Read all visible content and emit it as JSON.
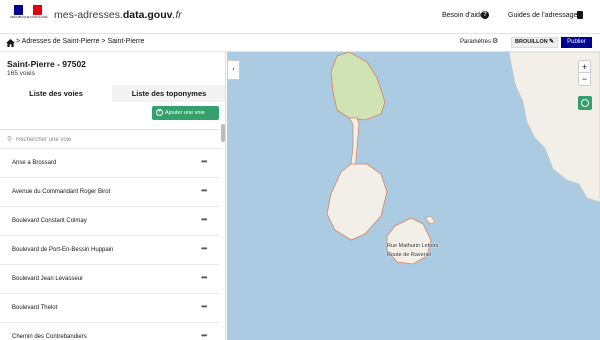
{
  "header": {
    "logo_text": "RÉPUBLIQUE FRANÇAISE",
    "site_prefix": "mes-adresses.",
    "site_brand": "data.gouv",
    "site_suffix": ".fr",
    "help_label": "Besoin d'aide",
    "guides_label": "Guides de l'adressage",
    "colors": {
      "blue": "#000091",
      "red": "#e1000f"
    }
  },
  "breadcrumb": {
    "path": "> Adresses de Saint-Pierre > Saint-Pierre",
    "settings_label": "Paramètres",
    "draft_label": "BROUILLON",
    "publish_label": "Publier"
  },
  "sidebar": {
    "commune_title": "Saint-Pierre - 97502",
    "voies_count": "165 voies",
    "tabs": [
      {
        "label": "Liste des voies",
        "active": true
      },
      {
        "label": "Liste des toponymes",
        "active": false
      }
    ],
    "add_button_label": "Ajouter une voie",
    "search_placeholder": "Rechercher une voie",
    "voies": [
      {
        "name": "Anse a Brossard"
      },
      {
        "name": "Avenue du Commandant Roger Birot"
      },
      {
        "name": "Boulevard Constant Colmay"
      },
      {
        "name": "Boulevard de Port-En-Bessin Huppain"
      },
      {
        "name": "Boulevard Jean Levasseur"
      },
      {
        "name": "Boulevard Thelot"
      },
      {
        "name": "Chemin des Contrebandiers"
      }
    ],
    "row_action_icon": "more-icon"
  },
  "map": {
    "labels": [
      "Rue Mathurin Lehors",
      "Route de Ravenel"
    ],
    "colors": {
      "sea": "#abcbe3",
      "land": "#f2efe9",
      "park": "#cfe3b4",
      "boundary": "#d9805a",
      "accent": "#34a06d"
    },
    "zoom_in_label": "+",
    "zoom_out_label": "−",
    "collapse_label": "‹"
  }
}
